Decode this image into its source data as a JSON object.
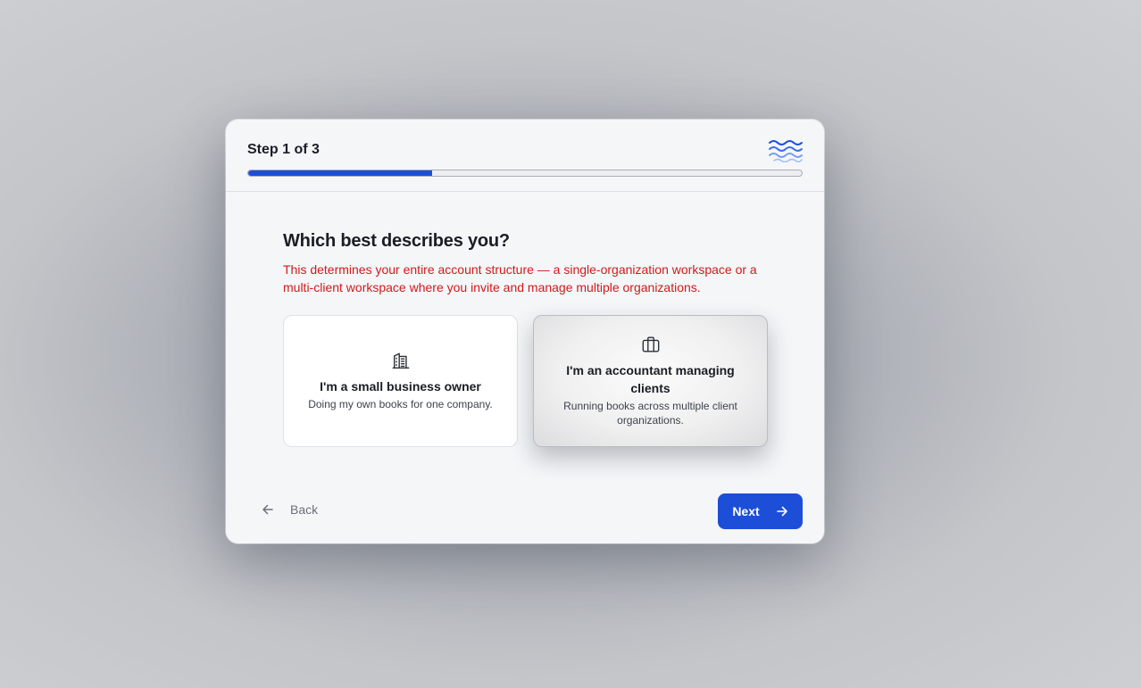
{
  "header": {
    "step_label": "Step 1 of 3",
    "progress_fraction": 0.333,
    "logo_icon": "waves-logo-icon"
  },
  "question": {
    "title": "Which best describes you?",
    "description": "This determines your entire account structure — a single-organization workspace or a multi-client workspace where you invite and manage multiple organizations."
  },
  "options": [
    {
      "icon": "building-icon",
      "title": "I'm a small business owner",
      "description": "Doing my own books for one company."
    },
    {
      "icon": "briefcase-icon",
      "title": "I'm an accountant managing clients",
      "description": "Running books across multiple client organizations."
    }
  ],
  "footer": {
    "back_label": "Back",
    "next_label": "Next"
  },
  "colors": {
    "accent": "#1d4ed8",
    "warning_text": "#d11a1a"
  }
}
